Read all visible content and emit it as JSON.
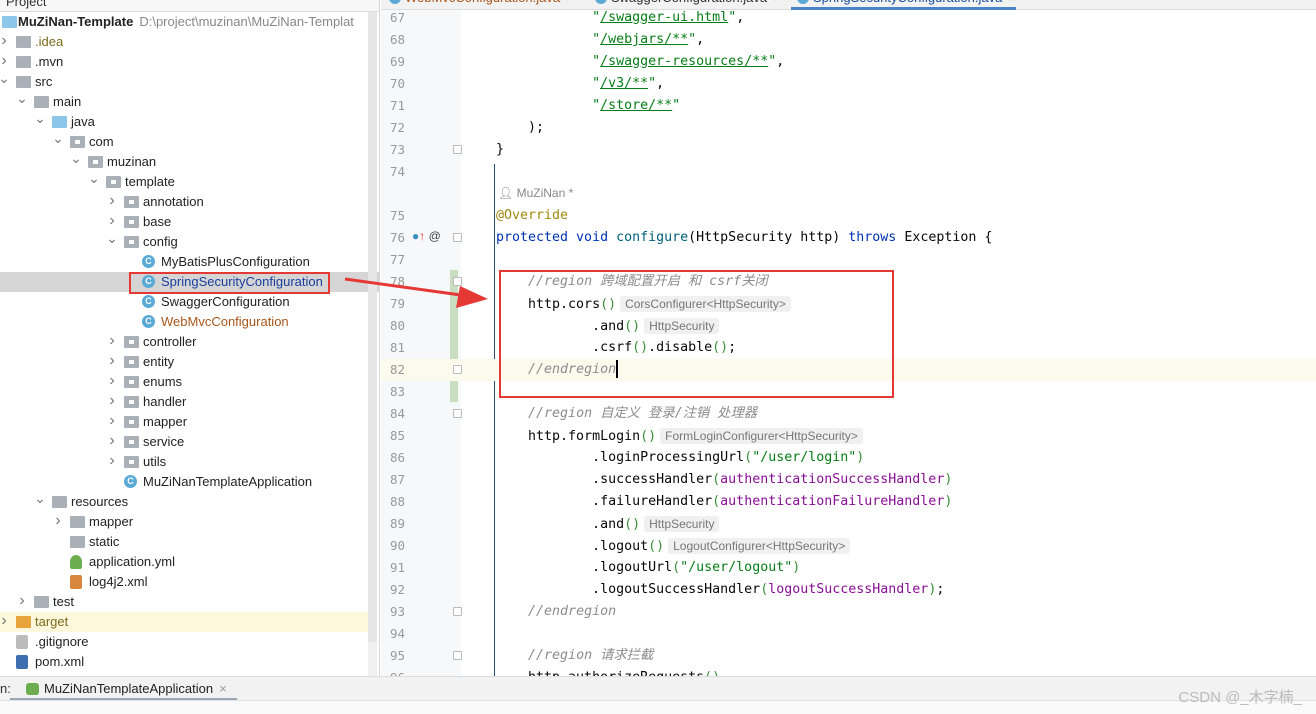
{
  "sidebar": {
    "header": "Project",
    "project_name": "MuZiNan-Template",
    "project_path": "D:\\project\\muzinan\\MuZiNan-Templat",
    "tree": [
      {
        "depth": 0,
        "arrow": ">",
        "icon": "fold",
        "label": ".idea",
        "color": "#7a6a1e"
      },
      {
        "depth": 0,
        "arrow": ">",
        "icon": "fold",
        "label": ".mvn"
      },
      {
        "depth": 0,
        "arrow": "v",
        "icon": "fold",
        "label": "src"
      },
      {
        "depth": 1,
        "arrow": "v",
        "icon": "fold",
        "label": "main"
      },
      {
        "depth": 2,
        "arrow": "v",
        "icon": "fold src",
        "label": "java"
      },
      {
        "depth": 3,
        "arrow": "v",
        "icon": "fold pkg",
        "label": "com"
      },
      {
        "depth": 4,
        "arrow": "v",
        "icon": "fold pkg",
        "label": "muzinan"
      },
      {
        "depth": 5,
        "arrow": "v",
        "icon": "fold pkg",
        "label": "template"
      },
      {
        "depth": 6,
        "arrow": ">",
        "icon": "fold pkg",
        "label": "annotation"
      },
      {
        "depth": 6,
        "arrow": ">",
        "icon": "fold pkg",
        "label": "base"
      },
      {
        "depth": 6,
        "arrow": "v",
        "icon": "fold pkg",
        "label": "config"
      },
      {
        "depth": 7,
        "arrow": "",
        "icon": "cls",
        "label": "MyBatisPlusConfiguration"
      },
      {
        "depth": 7,
        "arrow": "",
        "icon": "cls",
        "label": "SpringSecurityConfiguration",
        "color": "#1a3f9e",
        "selected": true
      },
      {
        "depth": 7,
        "arrow": "",
        "icon": "cls",
        "label": "SwaggerConfiguration"
      },
      {
        "depth": 7,
        "arrow": "",
        "icon": "cls",
        "label": "WebMvcConfiguration",
        "color": "#a8561c"
      },
      {
        "depth": 6,
        "arrow": ">",
        "icon": "fold pkg",
        "label": "controller"
      },
      {
        "depth": 6,
        "arrow": ">",
        "icon": "fold pkg",
        "label": "entity"
      },
      {
        "depth": 6,
        "arrow": ">",
        "icon": "fold pkg",
        "label": "enums"
      },
      {
        "depth": 6,
        "arrow": ">",
        "icon": "fold pkg",
        "label": "handler"
      },
      {
        "depth": 6,
        "arrow": ">",
        "icon": "fold pkg",
        "label": "mapper"
      },
      {
        "depth": 6,
        "arrow": ">",
        "icon": "fold pkg",
        "label": "service"
      },
      {
        "depth": 6,
        "arrow": ">",
        "icon": "fold pkg",
        "label": "utils"
      },
      {
        "depth": 6,
        "arrow": "",
        "icon": "cls",
        "label": "MuZiNanTemplateApplication"
      },
      {
        "depth": 2,
        "arrow": "v",
        "icon": "fold res",
        "label": "resources"
      },
      {
        "depth": 3,
        "arrow": ">",
        "icon": "fold",
        "label": "mapper"
      },
      {
        "depth": 3,
        "arrow": "",
        "icon": "fold",
        "label": "static"
      },
      {
        "depth": 3,
        "arrow": "",
        "icon": "file yml",
        "label": "application.yml"
      },
      {
        "depth": 3,
        "arrow": "",
        "icon": "file xml",
        "label": "log4j2.xml"
      },
      {
        "depth": 1,
        "arrow": ">",
        "icon": "fold",
        "label": "test"
      },
      {
        "depth": 0,
        "arrow": ">",
        "icon": "fold tgt",
        "label": "target",
        "color": "#7a6a1e",
        "target": true
      },
      {
        "depth": 0,
        "arrow": "",
        "icon": "file git",
        "label": ".gitignore"
      },
      {
        "depth": 0,
        "arrow": "",
        "icon": "file pom",
        "label": "pom.xml"
      }
    ]
  },
  "tabs": [
    {
      "label": "WebMvcConfiguration.java",
      "color": "#a8561c"
    },
    {
      "label": "SwaggerConfiguration.java"
    },
    {
      "label": "SpringSecurityConfiguration.java",
      "active": true
    }
  ],
  "tab_close": "×",
  "editor": {
    "author_hint": "MuZiNan *",
    "lines": [
      {
        "n": 67,
        "t": [
          [
            "",
            "            "
          ],
          [
            "t-str",
            "\""
          ],
          [
            "t-url",
            "/swagger-ui.html"
          ],
          [
            "t-str",
            "\""
          ],
          [
            "",
            ","
          ]
        ]
      },
      {
        "n": 68,
        "t": [
          [
            "",
            "            "
          ],
          [
            "t-str",
            "\""
          ],
          [
            "t-url",
            "/webjars/**"
          ],
          [
            "t-str",
            "\""
          ],
          [
            "",
            ","
          ]
        ]
      },
      {
        "n": 69,
        "t": [
          [
            "",
            "            "
          ],
          [
            "t-str",
            "\""
          ],
          [
            "t-url",
            "/swagger-resources/**"
          ],
          [
            "t-str",
            "\""
          ],
          [
            "",
            ","
          ]
        ]
      },
      {
        "n": 70,
        "t": [
          [
            "",
            "            "
          ],
          [
            "t-str",
            "\""
          ],
          [
            "t-url",
            "/v3/**"
          ],
          [
            "t-str",
            "\""
          ],
          [
            "",
            ","
          ]
        ]
      },
      {
        "n": 71,
        "t": [
          [
            "",
            "            "
          ],
          [
            "t-str",
            "\""
          ],
          [
            "t-url",
            "/store/**"
          ],
          [
            "t-str",
            "\""
          ]
        ]
      },
      {
        "n": 72,
        "t": [
          [
            "",
            "    );"
          ]
        ]
      },
      {
        "n": 73,
        "t": [
          [
            "",
            "}"
          ]
        ]
      },
      {
        "n": 74,
        "t": []
      },
      {
        "n": 75,
        "t": [
          [
            "t-ann",
            "@Override"
          ]
        ]
      },
      {
        "n": 76,
        "t": [
          [
            "t-kw",
            "protected void "
          ],
          [
            "t-fn",
            "configure"
          ],
          [
            "",
            "(HttpSecurity http) "
          ],
          [
            "t-kw",
            "throws "
          ],
          [
            "",
            "Exception {"
          ]
        ]
      },
      {
        "n": 77,
        "t": []
      },
      {
        "n": 78,
        "t": [
          [
            "",
            "    "
          ],
          [
            "t-cm",
            "//region 跨域配置开启 和 csrf关闭"
          ]
        ]
      },
      {
        "n": 79,
        "t": [
          [
            "",
            "    http.cors"
          ],
          [
            "t-par",
            "()"
          ],
          [
            "t-hint",
            "CorsConfigurer<HttpSecurity>"
          ]
        ]
      },
      {
        "n": 80,
        "t": [
          [
            "",
            "            .and"
          ],
          [
            "t-par",
            "()"
          ],
          [
            "t-hint",
            "HttpSecurity"
          ]
        ]
      },
      {
        "n": 81,
        "t": [
          [
            "",
            "            .csrf"
          ],
          [
            "t-par",
            "()"
          ],
          [
            "",
            ".disable"
          ],
          [
            "t-par",
            "()"
          ],
          [
            "",
            ";"
          ]
        ]
      },
      {
        "n": 82,
        "t": [
          [
            "",
            "    "
          ],
          [
            "t-cm",
            "//endregion"
          ]
        ],
        "current": true
      },
      {
        "n": 83,
        "t": []
      },
      {
        "n": 84,
        "t": [
          [
            "",
            "    "
          ],
          [
            "t-cm",
            "//region 自定义 登录/注销 处理器"
          ]
        ]
      },
      {
        "n": 85,
        "t": [
          [
            "",
            "    http.formLogin"
          ],
          [
            "t-par",
            "()"
          ],
          [
            "t-hint",
            "FormLoginConfigurer<HttpSecurity>"
          ]
        ]
      },
      {
        "n": 86,
        "t": [
          [
            "",
            "            .loginProcessingUrl"
          ],
          [
            "t-par",
            "("
          ],
          [
            "t-str",
            "\"/user/login\""
          ],
          [
            "t-par",
            ")"
          ]
        ]
      },
      {
        "n": 87,
        "t": [
          [
            "",
            "            .successHandler"
          ],
          [
            "t-par",
            "("
          ],
          [
            "t-fld",
            "authenticationSuccessHandler"
          ],
          [
            "t-par",
            ")"
          ]
        ]
      },
      {
        "n": 88,
        "t": [
          [
            "",
            "            .failureHandler"
          ],
          [
            "t-par",
            "("
          ],
          [
            "t-fld",
            "authenticationFailureHandler"
          ],
          [
            "t-par",
            ")"
          ]
        ]
      },
      {
        "n": 89,
        "t": [
          [
            "",
            "            .and"
          ],
          [
            "t-par",
            "()"
          ],
          [
            "t-hint",
            "HttpSecurity"
          ]
        ]
      },
      {
        "n": 90,
        "t": [
          [
            "",
            "            .logout"
          ],
          [
            "t-par",
            "()"
          ],
          [
            "t-hint",
            "LogoutConfigurer<HttpSecurity>"
          ]
        ]
      },
      {
        "n": 91,
        "t": [
          [
            "",
            "            .logoutUrl"
          ],
          [
            "t-par",
            "("
          ],
          [
            "t-str",
            "\"/user/logout\""
          ],
          [
            "t-par",
            ")"
          ]
        ]
      },
      {
        "n": 92,
        "t": [
          [
            "",
            "            .logoutSuccessHandler"
          ],
          [
            "t-par",
            "("
          ],
          [
            "t-fld",
            "logoutSuccessHandler"
          ],
          [
            "t-par",
            ")"
          ],
          [
            "",
            ";"
          ]
        ]
      },
      {
        "n": 93,
        "t": [
          [
            "",
            "    "
          ],
          [
            "t-cm",
            "//endregion"
          ]
        ]
      },
      {
        "n": 94,
        "t": []
      },
      {
        "n": 95,
        "t": [
          [
            "",
            "    "
          ],
          [
            "t-cm",
            "//region 请求拦截"
          ]
        ]
      },
      {
        "n": 96,
        "t": [
          [
            "",
            "    http.authorizeRequests"
          ],
          [
            "t-par",
            "()"
          ]
        ]
      }
    ]
  },
  "runbar": {
    "label": "n:",
    "tab": "MuZiNanTemplateApplication",
    "close": "×"
  },
  "watermark": "CSDN @_木字楠_",
  "colors": {
    "highlight_box": "#e53935",
    "selection": "#d5d5d5"
  }
}
